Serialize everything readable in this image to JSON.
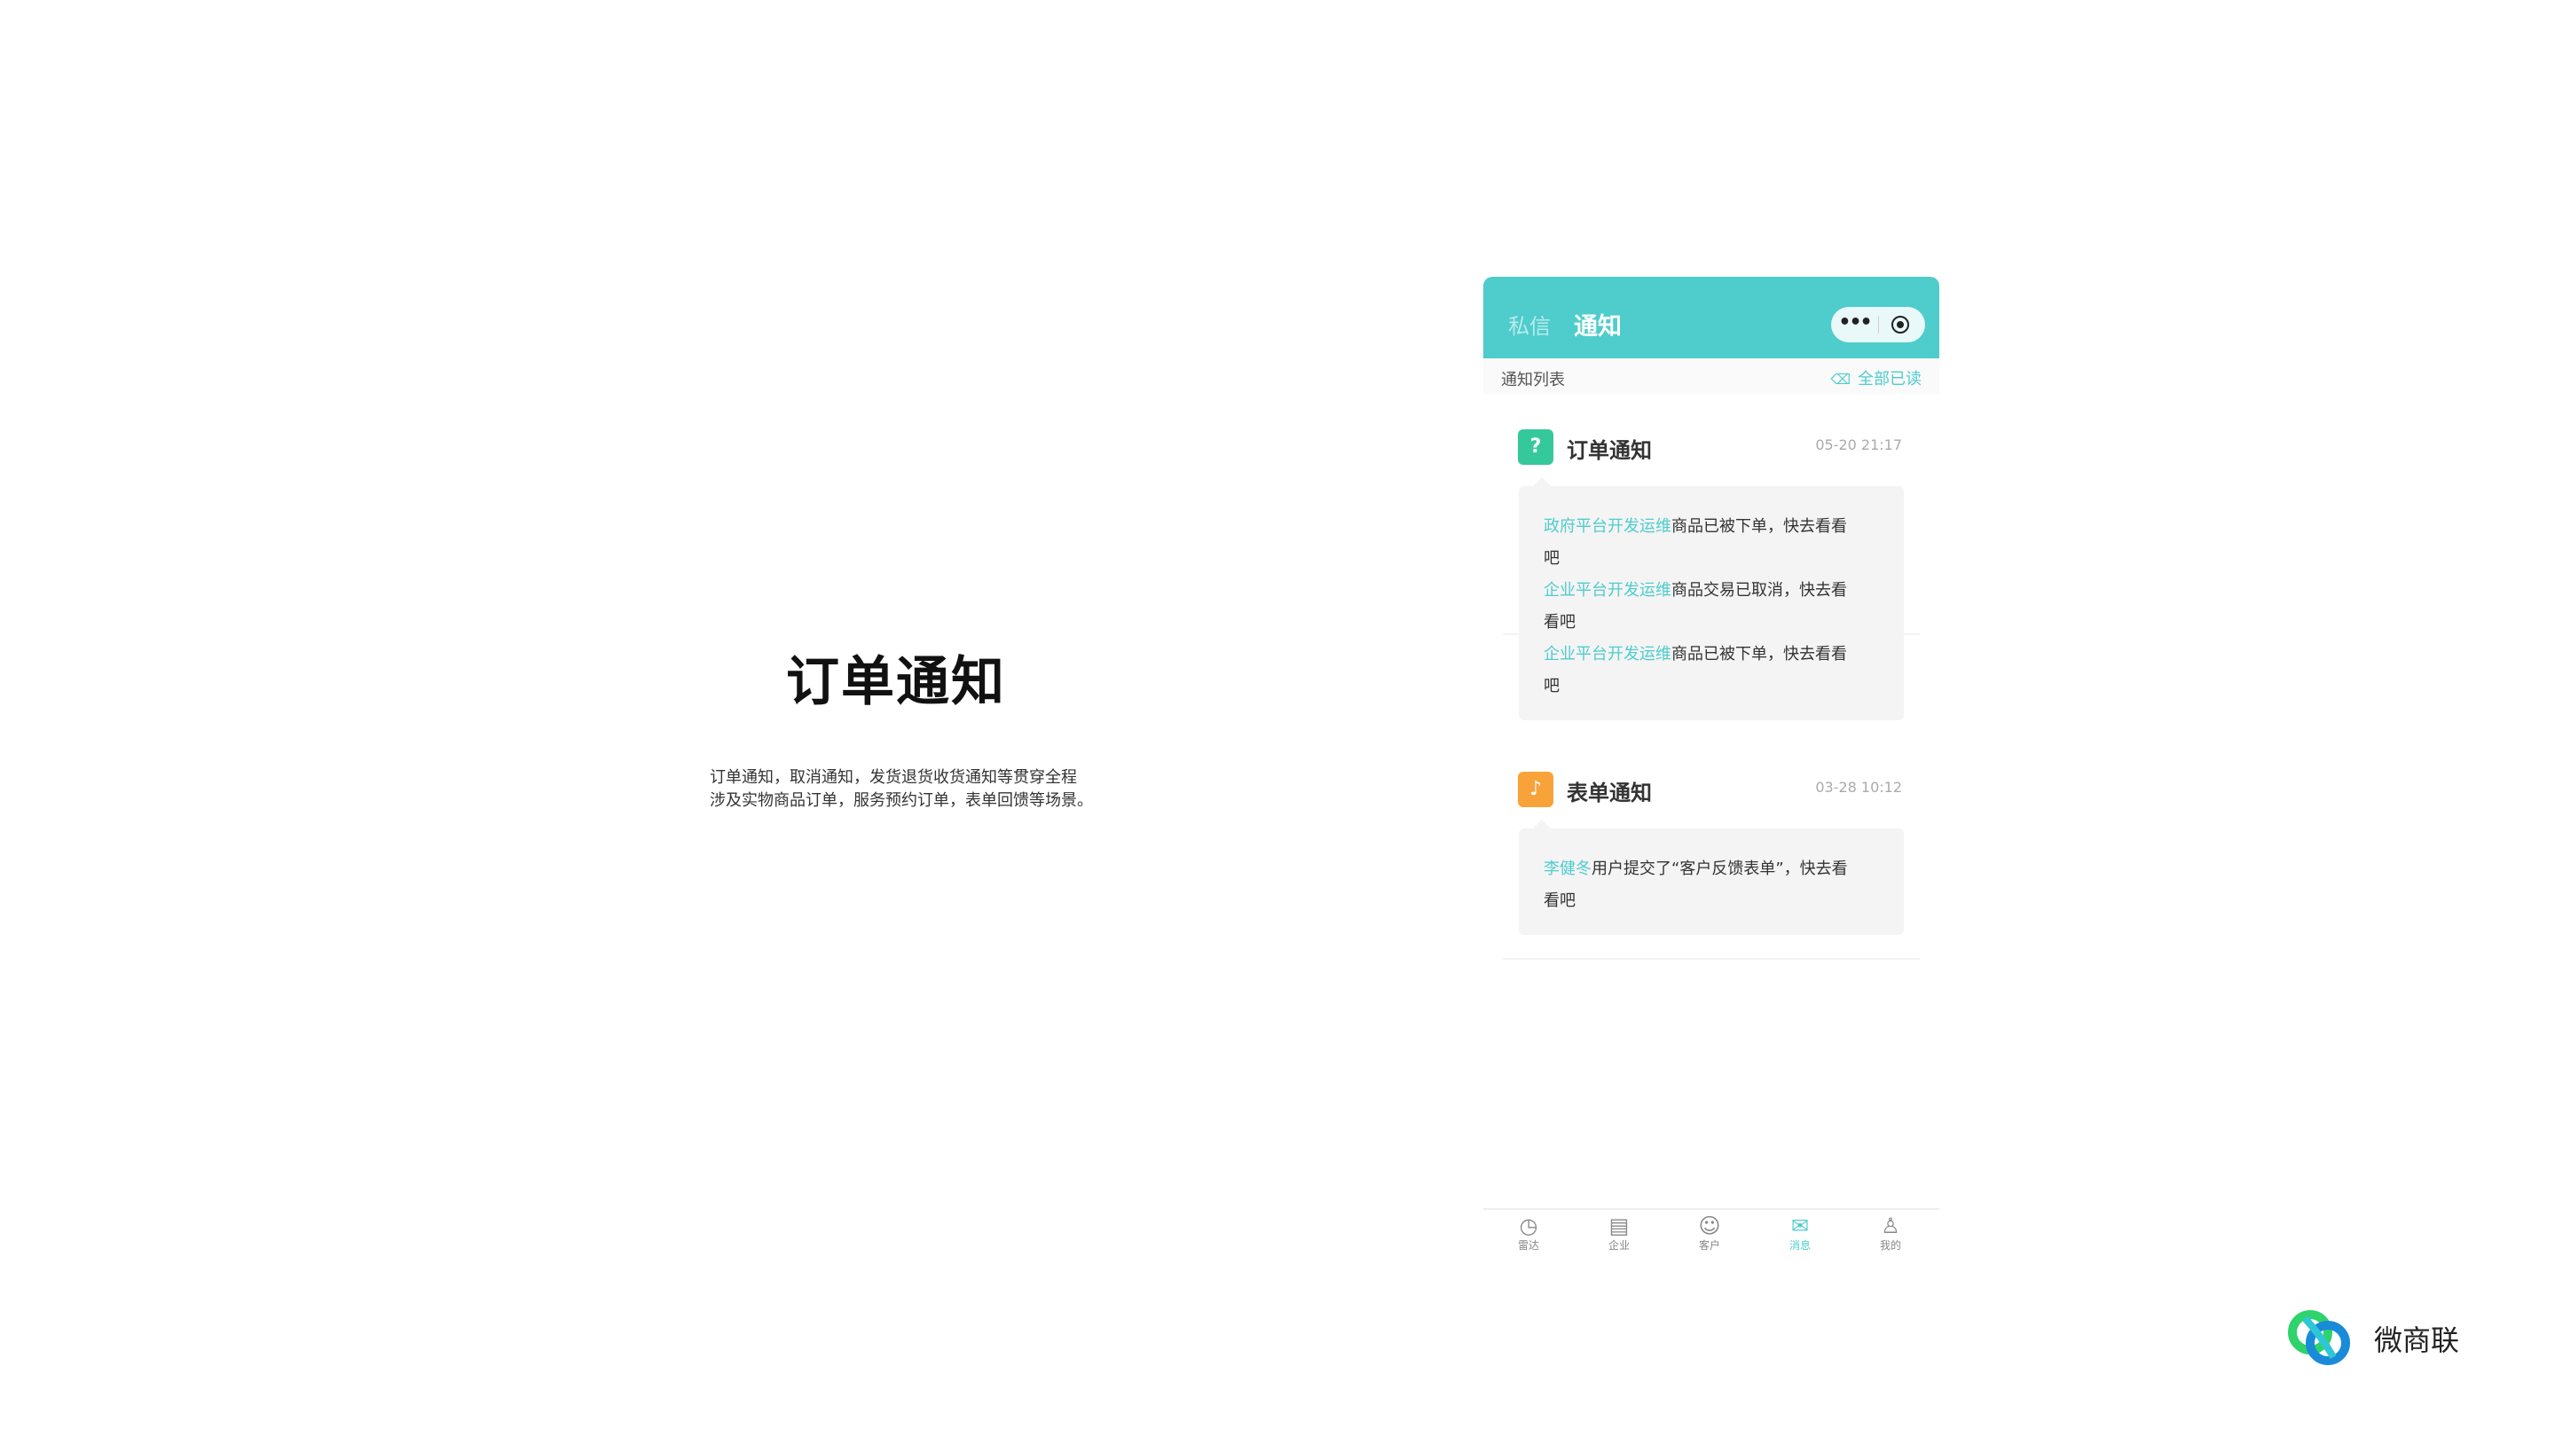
{
  "intro": {
    "title": "订单通知",
    "desc_line1": "订单通知，取消通知，发货退货收货通知等贯穿全程",
    "desc_line2": "涉及实物商品订单，服务预约订单，表单回馈等场景。"
  },
  "phone": {
    "tabs": {
      "private": "私信",
      "notify": "通知"
    },
    "capsule": {
      "more": "•••"
    },
    "sub_header": {
      "title": "通知列表",
      "mark_all": "全部已读"
    },
    "cards": [
      {
        "title": "订单通知",
        "time": "05-20 21:17",
        "icon": "question-icon",
        "lines": [
          {
            "hl": "政府平台开发运维",
            "text": "商品已被下单，快去看看",
            "tail": "吧"
          },
          {
            "hl": "企业平台开发运维",
            "text": "商品交易已取消，快去看",
            "tail": "看吧"
          },
          {
            "hl": "企业平台开发运维",
            "text": "商品已被下单，快去看看",
            "tail": "吧"
          }
        ]
      },
      {
        "title": "表单通知",
        "time": "03-28 10:12",
        "icon": "bell-icon",
        "lines": [
          {
            "hl": "李健冬",
            "text": "用户提交了“客户反馈表单”，快去看",
            "tail": "看吧"
          }
        ]
      }
    ],
    "nav": [
      {
        "label": "雷达",
        "icon": "radar-icon",
        "glyph": "◷",
        "active": false
      },
      {
        "label": "企业",
        "icon": "building-icon",
        "glyph": "▤",
        "active": false
      },
      {
        "label": "客户",
        "icon": "contact-icon",
        "glyph": "☺",
        "active": false
      },
      {
        "label": "消息",
        "icon": "chat-icon",
        "glyph": "✉",
        "active": true
      },
      {
        "label": "我的",
        "icon": "user-icon",
        "glyph": "♙",
        "active": false
      }
    ],
    "colors": {
      "accent": "#4fcccc",
      "green": "#35c89a",
      "orange": "#f7a33a"
    }
  },
  "brand": {
    "name": "微商联"
  }
}
